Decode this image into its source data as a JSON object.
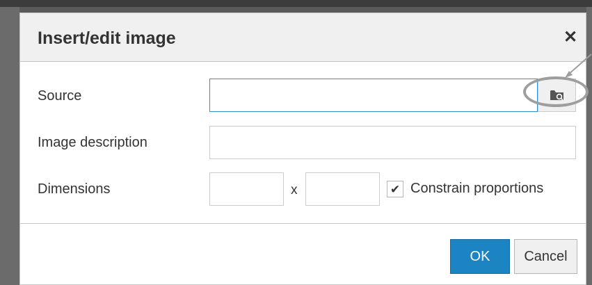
{
  "dialog": {
    "title": "Insert/edit image",
    "close_glyph": "✕",
    "close_icon": "close-icon"
  },
  "fields": {
    "source": {
      "label": "Source",
      "value": "",
      "browse_icon": "folder-search-icon"
    },
    "description": {
      "label": "Image description",
      "value": ""
    },
    "dimensions": {
      "label": "Dimensions",
      "width_value": "",
      "separator": "x",
      "height_value": "",
      "constrain_label": "Constrain proportions",
      "constrain_checked": true,
      "check_glyph": "✔",
      "check_icon": "checkmark-icon"
    }
  },
  "footer": {
    "ok_label": "OK",
    "cancel_label": "Cancel"
  },
  "annotation": {
    "highlight": "browse-button",
    "color": "#9e9e9e"
  },
  "colors": {
    "primary": "#1d84c4",
    "focus_border": "#2e8fd6",
    "header_bg": "#f0f0f0"
  }
}
